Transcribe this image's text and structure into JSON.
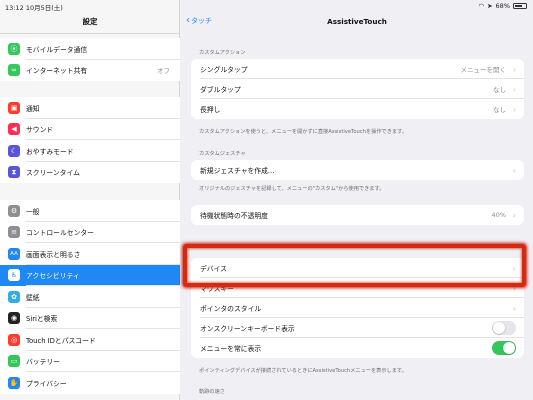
{
  "status_bar": {
    "time": "13:12",
    "date": "10月5日(土)",
    "battery_percent": "68%",
    "battery_level": 0.68
  },
  "sidebar": {
    "title": "設定",
    "groups": [
      [
        {
          "label": "モバイルデータ通信",
          "icon": "antenna-icon",
          "color": "#34c759",
          "glyph": "⦿"
        },
        {
          "label": "インターネット共有",
          "icon": "link-icon",
          "color": "#34c759",
          "glyph": "∞",
          "value": "オフ"
        }
      ],
      [
        {
          "label": "通知",
          "icon": "notification-icon",
          "color": "#ff3b30",
          "glyph": "▣"
        },
        {
          "label": "サウンド",
          "icon": "speaker-icon",
          "color": "#ff2d55",
          "glyph": "◀"
        },
        {
          "label": "おやすみモード",
          "icon": "moon-icon",
          "color": "#5856d6",
          "glyph": "☾"
        },
        {
          "label": "スクリーンタイム",
          "icon": "hourglass-icon",
          "color": "#5856d6",
          "glyph": "⧗"
        }
      ],
      [
        {
          "label": "一般",
          "icon": "gear-icon",
          "color": "#8e8e93",
          "glyph": "⚙"
        },
        {
          "label": "コントロールセンター",
          "icon": "switches-icon",
          "color": "#8e8e93",
          "glyph": "≡"
        },
        {
          "label": "画面表示と明るさ",
          "icon": "display-icon",
          "color": "#1f88f4",
          "glyph": "AA"
        },
        {
          "label": "アクセシビリティ",
          "icon": "accessibility-icon",
          "color": "#1f88f4",
          "glyph": "♿",
          "active": true
        },
        {
          "label": "壁紙",
          "icon": "wallpaper-icon",
          "color": "#32ade6",
          "glyph": "✿"
        },
        {
          "label": "Siriと検索",
          "icon": "siri-icon",
          "color": "#222222",
          "glyph": "◉"
        },
        {
          "label": "Touch IDとパスコード",
          "icon": "fingerprint-icon",
          "color": "#ff3b30",
          "glyph": "◎"
        },
        {
          "label": "バッテリー",
          "icon": "battery-icon",
          "color": "#34c759",
          "glyph": "▭"
        },
        {
          "label": "プライバシー",
          "icon": "hand-icon",
          "color": "#1f88f4",
          "glyph": "✋"
        }
      ]
    ]
  },
  "detail": {
    "back_label": "タッチ",
    "title": "AssistiveTouch",
    "custom_actions": {
      "header": "カスタムアクション",
      "rows": [
        {
          "label": "シングルタップ",
          "value": "メニューを開く"
        },
        {
          "label": "ダブルタップ",
          "value": "なし"
        },
        {
          "label": "長押し",
          "value": "なし"
        }
      ],
      "footer": "カスタムアクションを使うと、メニューを開かずに直接AssistiveTouchを操作できます。"
    },
    "custom_gestures": {
      "header": "カスタムジェスチャ",
      "rows": [
        {
          "label": "新規ジェスチャを作成..."
        }
      ],
      "footer": "オリジナルのジェスチャを記録して、メニューの\"カスタム\"から使用できます。"
    },
    "idle_opacity": {
      "label": "待機状態時の不透明度",
      "value": "40%"
    },
    "pointer": {
      "rows": [
        {
          "label": "デバイス"
        },
        {
          "label": "マウスキー"
        },
        {
          "label": "ポインタのスタイル"
        },
        {
          "label": "オンスクリーンキーボード表示",
          "toggle": false
        },
        {
          "label": "メニューを常に表示",
          "toggle": true
        }
      ],
      "footer": "ポインティングデバイスが接続されているときにAssistiveTouchメニューを表示します。"
    },
    "tracking": {
      "header": "軌跡の速さ"
    }
  }
}
